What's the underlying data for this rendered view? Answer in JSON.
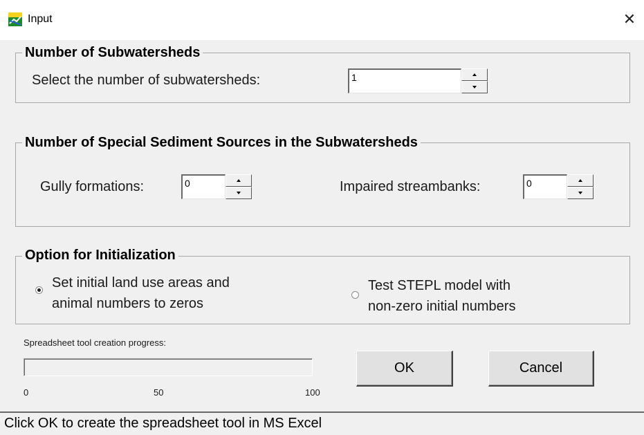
{
  "window": {
    "title": "Input",
    "app_icon": "stepl-app-icon",
    "close_icon": "close-x-icon",
    "close_glyph": "✕"
  },
  "subwatersheds": {
    "legend": "Number of Subwatersheds",
    "label": "Select the number of subwatersheds:",
    "value": "1"
  },
  "sediment_sources": {
    "legend": "Number of Special Sediment Sources in the Subwatersheds",
    "gully_label": "Gully formations:",
    "gully_value": "0",
    "streambanks_label": "Impaired streambanks:",
    "streambanks_value": "0"
  },
  "initialization": {
    "legend": "Option for Initialization",
    "options": [
      {
        "line1": "Set initial land use areas and",
        "line2": "animal numbers to zeros",
        "checked": true
      },
      {
        "line1": "Test STEPL model with",
        "line2": "non-zero initial numbers",
        "checked": false
      }
    ]
  },
  "progress": {
    "label": "Spreadsheet tool creation progress:",
    "value_percent": 0,
    "ticks": [
      "0",
      "50",
      "100"
    ]
  },
  "buttons": {
    "ok": "OK",
    "cancel": "Cancel"
  },
  "status": {
    "text": "Click OK to create the spreadsheet tool in MS Excel"
  }
}
